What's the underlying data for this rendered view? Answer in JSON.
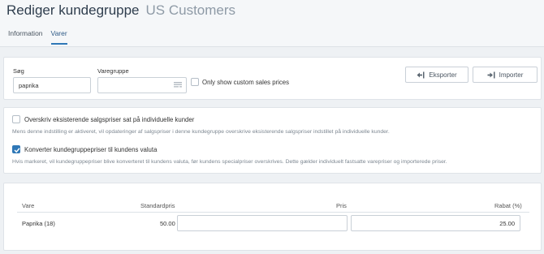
{
  "header": {
    "title": "Rediger kundegruppe",
    "subtitle": "US Customers",
    "tabs": [
      {
        "label": "Information"
      },
      {
        "label": "Varer"
      }
    ]
  },
  "filters": {
    "search_label": "Søg",
    "search_value": "paprika",
    "group_label": "Varegruppe",
    "group_value": "",
    "custom_prices_label": "Only show custom sales prices",
    "export_label": "Eksporter",
    "import_label": "Importer"
  },
  "options": {
    "overwrite_label": "Overskriv eksisterende salgspriser sat på individuelle kunder",
    "overwrite_checked": false,
    "overwrite_help": "Mens denne indstilling er aktiveret, vil opdateringer af salgspriser i denne kundegruppe overskrive eksisterende salgspriser indstillet på individuelle kunder.",
    "convert_label": "Konverter kundegruppepriser til kundens valuta",
    "convert_checked": true,
    "convert_help": "Hvis markeret, vil kundegruppepriser blive konverteret til kundens valuta, før kundens specialpriser overskrives. Dette gælder individuelt fastsatte varepriser og importerede priser."
  },
  "table": {
    "headers": {
      "vare": "Vare",
      "standardpris": "Standardpris",
      "pris": "Pris",
      "rabat": "Rabat (%)"
    },
    "rows": [
      {
        "vare": "Paprika (18)",
        "standardpris": "50.00",
        "pris": "",
        "rabat": "25.00"
      }
    ]
  },
  "colors": {
    "accent": "#2f78b7",
    "background": "#eef1f4"
  }
}
